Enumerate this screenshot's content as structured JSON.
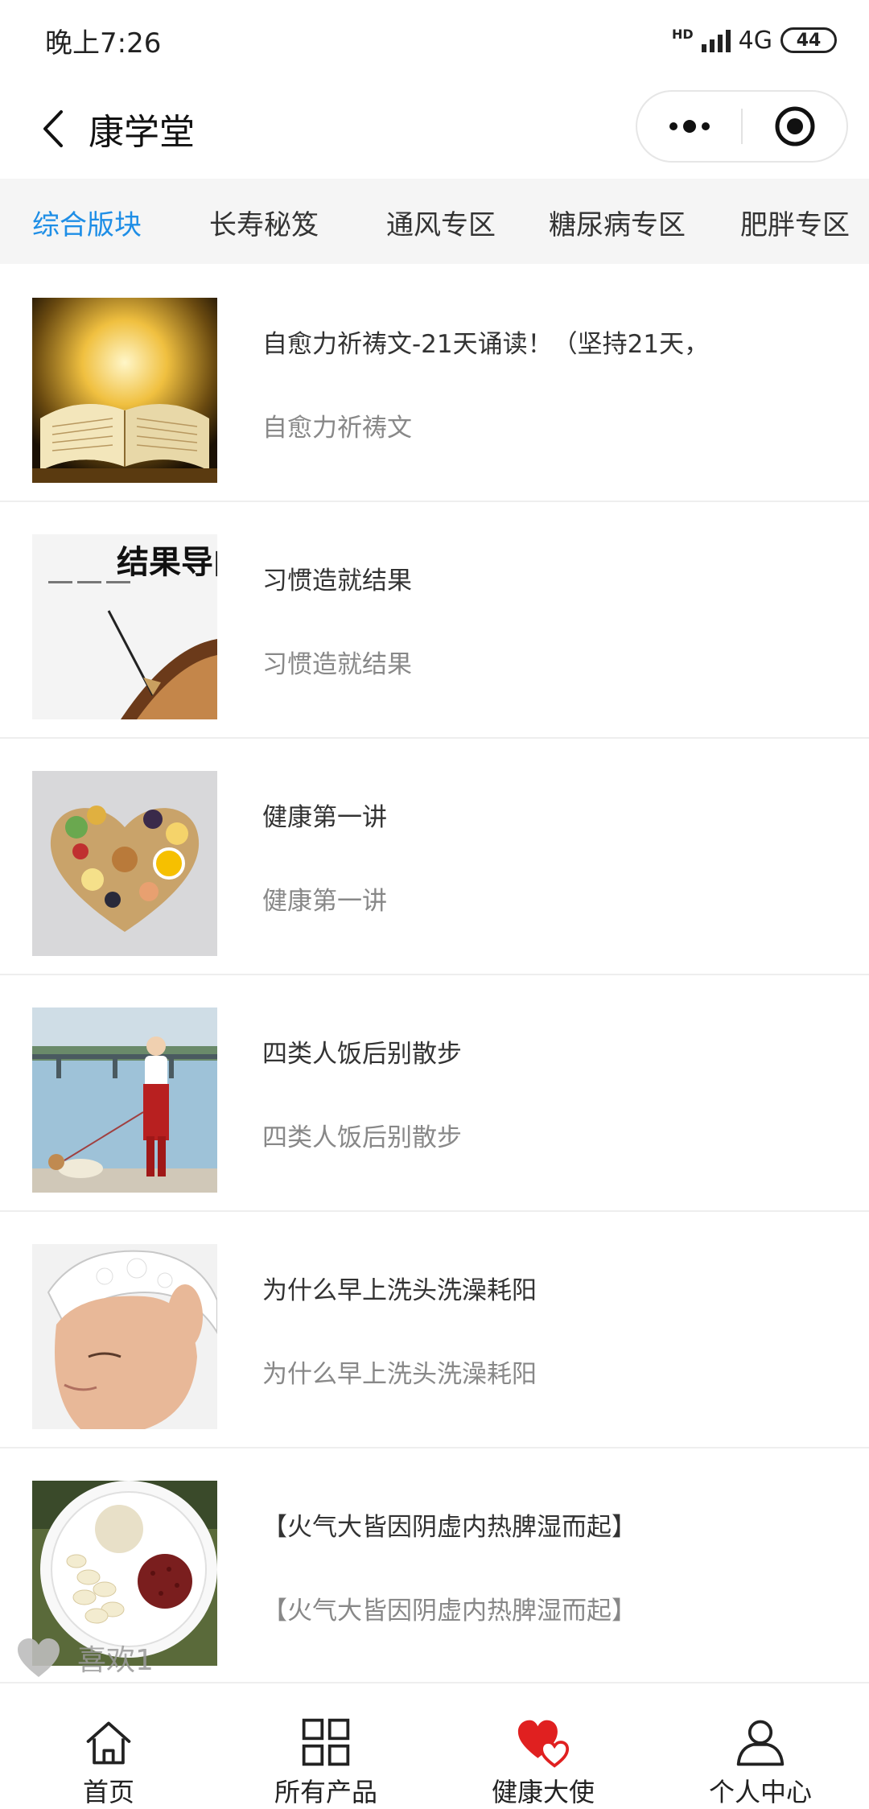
{
  "status": {
    "time": "晚上7:26",
    "network": "4G",
    "hd": "HD",
    "battery": "44"
  },
  "nav": {
    "title": "康学堂"
  },
  "tabs": [
    {
      "label": "综合版块",
      "active": true
    },
    {
      "label": "长寿秘笈",
      "active": false
    },
    {
      "label": "通风专区",
      "active": false
    },
    {
      "label": "糖尿病专区",
      "active": false
    },
    {
      "label": "肥胖专区",
      "active": false
    }
  ],
  "items": [
    {
      "title": "自愈力祈祷文-21天诵读！（坚持21天，",
      "subtitle": "自愈力祈祷文",
      "thumb": "bible-image"
    },
    {
      "title": "习惯造就结果",
      "subtitle": "习惯造就结果",
      "thumb": "arrow-target-image",
      "thumb_text": "结果导向"
    },
    {
      "title": "健康第一讲",
      "subtitle": "健康第一讲",
      "thumb": "heart-food-image"
    },
    {
      "title": "四类人饭后别散步",
      "subtitle": "四类人饭后别散步",
      "thumb": "walking-dog-image"
    },
    {
      "title": "为什么早上洗头洗澡耗阳",
      "subtitle": "为什么早上洗头洗澡耗阳",
      "thumb": "hair-wash-image"
    },
    {
      "title": "【火气大皆因阴虚内热脾湿而起】",
      "subtitle": "【火气大皆因阴虚内热脾湿而起】",
      "thumb": "beans-bowl-image"
    }
  ],
  "like": {
    "label": "喜欢1"
  },
  "tabbar": [
    {
      "label": "首页",
      "icon": "home-icon"
    },
    {
      "label": "所有产品",
      "icon": "grid-icon"
    },
    {
      "label": "健康大使",
      "icon": "hearts-icon",
      "color": "#e02020"
    },
    {
      "label": "个人中心",
      "icon": "user-icon"
    }
  ],
  "colors": {
    "accent": "#1e8ee6",
    "heart": "#e02020"
  }
}
